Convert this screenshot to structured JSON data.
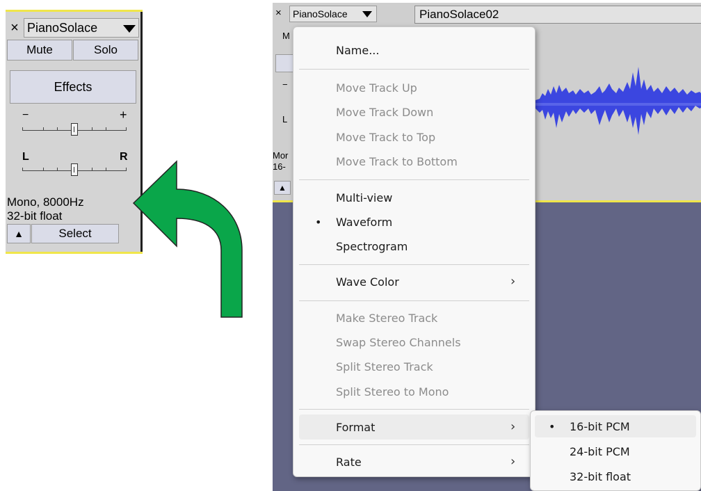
{
  "left_panel": {
    "close_glyph": "×",
    "track_name": "PianoSolace",
    "mute_label": "Mute",
    "solo_label": "Solo",
    "effects_label": "Effects",
    "gain_minus": "−",
    "gain_plus": "+",
    "pan_left": "L",
    "pan_right": "R",
    "info_line1": "Mono, 8000Hz",
    "info_line2": "32-bit float",
    "collapse_glyph": "▲",
    "select_label": "Select"
  },
  "right_shot": {
    "close_glyph": "×",
    "track_name": "PianoSolace",
    "clip_title": "PianoSolace02",
    "partial_m": "M",
    "partial_minus": "−",
    "partial_l": "L",
    "partial_mor": "Mor",
    "partial_16": "16-",
    "collapse_glyph": "▲"
  },
  "menu": {
    "name": "Name...",
    "move_up": "Move Track Up",
    "move_down": "Move Track Down",
    "move_top": "Move Track to Top",
    "move_bottom": "Move Track to Bottom",
    "multi_view": "Multi-view",
    "waveform": "Waveform",
    "spectrogram": "Spectrogram",
    "wave_color": "Wave Color",
    "make_stereo": "Make Stereo Track",
    "swap_stereo": "Swap Stereo Channels",
    "split_stereo": "Split Stereo Track",
    "split_mono": "Split Stereo to Mono",
    "format": "Format",
    "rate": "Rate",
    "bullet": "•",
    "submenu_arrow": "›"
  },
  "submenu": {
    "pcm16": "16-bit PCM",
    "pcm24": "24-bit PCM",
    "float32": "32-bit float",
    "bullet": "•"
  },
  "colors": {
    "arrow_green": "#0aa64a",
    "track_bg": "#626585",
    "wave_blue": "#3b46e0",
    "selection_yellow": "#f0e64a"
  }
}
